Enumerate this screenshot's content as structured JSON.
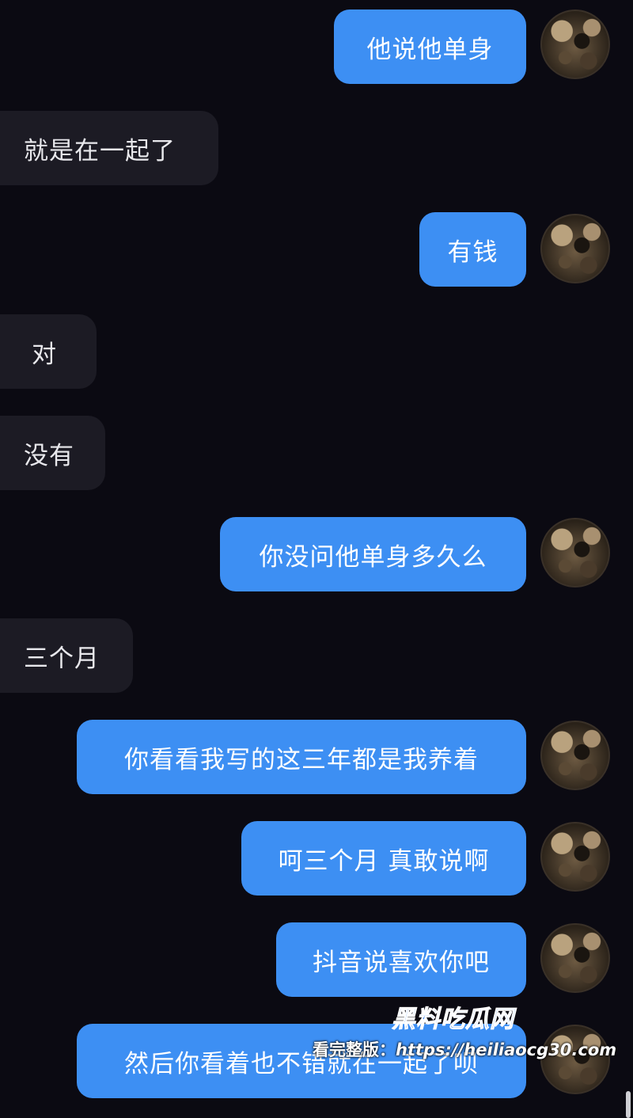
{
  "messages": [
    {
      "side": "out",
      "text": "他说他单身"
    },
    {
      "side": "in",
      "text": "就是在一起了"
    },
    {
      "side": "out",
      "text": "有钱"
    },
    {
      "side": "in",
      "text": "对"
    },
    {
      "side": "in",
      "text": "没有"
    },
    {
      "side": "out",
      "text": "你没问他单身多久么"
    },
    {
      "side": "in",
      "text": "三个月"
    },
    {
      "side": "out",
      "text": "你看看我写的这三年都是我养着"
    },
    {
      "side": "out",
      "text": "呵三个月 真敢说啊"
    },
    {
      "side": "out",
      "text": "抖音说喜欢你吧"
    },
    {
      "side": "out",
      "text": "然后你看着也不错就在一起了呗"
    }
  ],
  "watermark": {
    "title": "黑料吃瓜网",
    "label": "看完整版：",
    "url": "https://heiliaocg30.com"
  }
}
